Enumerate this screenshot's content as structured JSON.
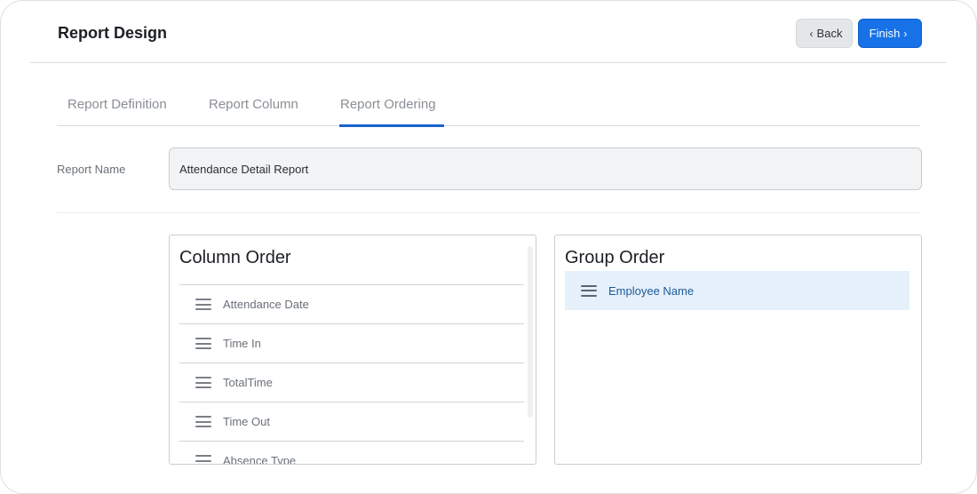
{
  "header": {
    "title": "Report Design",
    "back_label": "Back",
    "finish_label": "Finish"
  },
  "tabs": [
    {
      "label": "Report Definition",
      "active": false
    },
    {
      "label": "Report Column",
      "active": false
    },
    {
      "label": "Report Ordering",
      "active": true
    }
  ],
  "report_name": {
    "label": "Report Name",
    "value": "Attendance Detail Report"
  },
  "column_order": {
    "title": "Column Order",
    "items": [
      "Attendance Date",
      "Time In",
      "TotalTime",
      "Time Out",
      "Absence Type"
    ]
  },
  "group_order": {
    "title": "Group Order",
    "items": [
      "Employee Name"
    ]
  },
  "colors": {
    "accent": "#1672e6",
    "active_tab": "#1864d0",
    "group_highlight": "#e6f0fb"
  },
  "icons": {
    "back": "chevron-left-icon",
    "finish": "chevron-right-icon",
    "drag": "drag-handle-icon"
  }
}
